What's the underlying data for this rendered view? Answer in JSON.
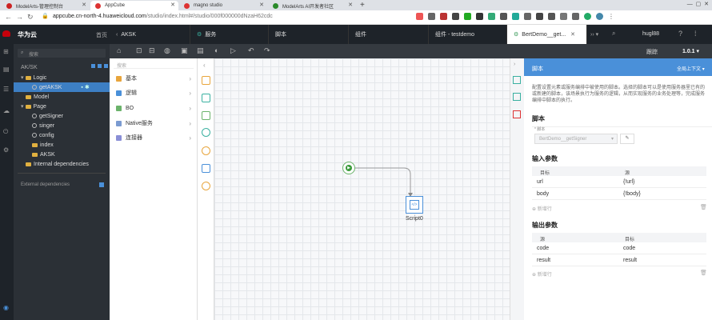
{
  "browser": {
    "tabs": [
      {
        "title": "ModelArts-管理控制台",
        "color": "#c22"
      },
      {
        "title": "AppCube",
        "color": "#d33"
      },
      {
        "title": "magno studio",
        "color": "#d33"
      },
      {
        "title": "ModelArts AI开发者社区",
        "color": "#2a8a2a"
      }
    ],
    "url_host": "appcube.cn-north-4.huaweicloud.com",
    "url_path": "/studio/index.html#/studio/000f000000dNzaH62cdc"
  },
  "app": {
    "logo": "华为云",
    "home": "首页",
    "tabs": [
      "AKSK",
      "服务",
      "脚本",
      "组件",
      "组件 - testdemo",
      "BertDemo__get..."
    ],
    "user": "hugl88",
    "version": "1.0.1",
    "debug": "跟踪"
  },
  "explorer": {
    "title": "AK/SK",
    "search_placeholder": "搜索",
    "items": [
      {
        "label": "Logic",
        "kind": "folder",
        "indent": 0
      },
      {
        "label": "getAKSK",
        "kind": "gear",
        "indent": 1,
        "selected": true
      },
      {
        "label": "Model",
        "kind": "folder",
        "indent": 0
      },
      {
        "label": "Page",
        "kind": "folder",
        "indent": 0
      },
      {
        "label": "getSigner",
        "kind": "gear",
        "indent": 1
      },
      {
        "label": "singer",
        "kind": "gear",
        "indent": 1
      },
      {
        "label": "config",
        "kind": "gear",
        "indent": 1
      },
      {
        "label": "index",
        "kind": "folder",
        "indent": 1
      },
      {
        "label": "AKSK",
        "kind": "folder",
        "indent": 1
      },
      {
        "label": "Internal dependencies",
        "kind": "folder",
        "indent": 0
      }
    ],
    "external": "External dependencies"
  },
  "components": {
    "search_placeholder": "搜索",
    "items": [
      {
        "label": "基本",
        "color": "#e8a53c"
      },
      {
        "label": "逻辑",
        "color": "#4a90d9"
      },
      {
        "label": "BO",
        "color": "#6bb36b"
      },
      {
        "label": "Native服务",
        "color": "#7b9bd1"
      },
      {
        "label": "连接器",
        "color": "#8a8fd6"
      }
    ]
  },
  "canvas": {
    "node_label": "Script0"
  },
  "panel": {
    "title": "脚本",
    "global_ctx": "全局上下文",
    "description": "配置设置元素或服务编排中被使用的脚本。选择的脚本可以是使用服务器里已有的或新建的脚本，该场景执行为服务的逻辑，从而实现服务的业务处理等，完成服务编排中脚本的执行。",
    "script_section": "脚本",
    "script_label": "* 脚本",
    "script_value": "BertDemo__getSigner",
    "input_section": "输入参数",
    "input_cols": [
      "目标",
      "源"
    ],
    "input_rows": [
      [
        "url",
        "{!url}"
      ],
      [
        "body",
        "{!body}"
      ]
    ],
    "add_row": "新增行",
    "output_section": "输出参数",
    "output_cols": [
      "源",
      "目标"
    ],
    "output_rows": [
      [
        "code",
        "code"
      ],
      [
        "result",
        "result"
      ]
    ]
  }
}
